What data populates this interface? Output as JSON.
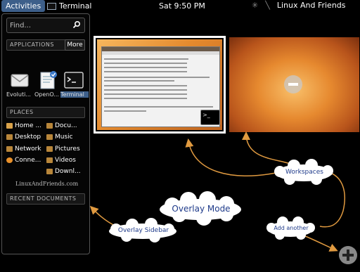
{
  "top_panel": {
    "activities_label": "Activities",
    "focused_app_label": "Terminal",
    "clock": "Sat  9:50 PM",
    "user_name": "Linux And Friends"
  },
  "sidebar": {
    "search_placeholder": "Find...",
    "applications_header": "APPLICATIONS",
    "more_label": "More",
    "apps": [
      {
        "label": "Evoluti..."
      },
      {
        "label": "OpenO..."
      },
      {
        "label": "Terminal"
      }
    ],
    "places_header": "PLACES",
    "places": [
      {
        "label": "Home ..."
      },
      {
        "label": "Docu..."
      },
      {
        "label": "Desktop"
      },
      {
        "label": "Music"
      },
      {
        "label": "Network"
      },
      {
        "label": "Pictures"
      },
      {
        "label": "Conne..."
      },
      {
        "label": "Videos"
      },
      {
        "label": "Downl..."
      }
    ],
    "site_link": "LinuxAndFriends.com",
    "recent_header": "RECENT DOCUMENTS"
  },
  "annotations": {
    "overlay_mode": "Overlay Mode",
    "overlay_sidebar": "Overlay Sidebar",
    "workspaces": "Workspaces",
    "add_another": "Add another"
  },
  "colors": {
    "activities_bg": "#3d5f8a",
    "cloud_text": "#1e3a8a",
    "arrow": "#e09a40"
  }
}
